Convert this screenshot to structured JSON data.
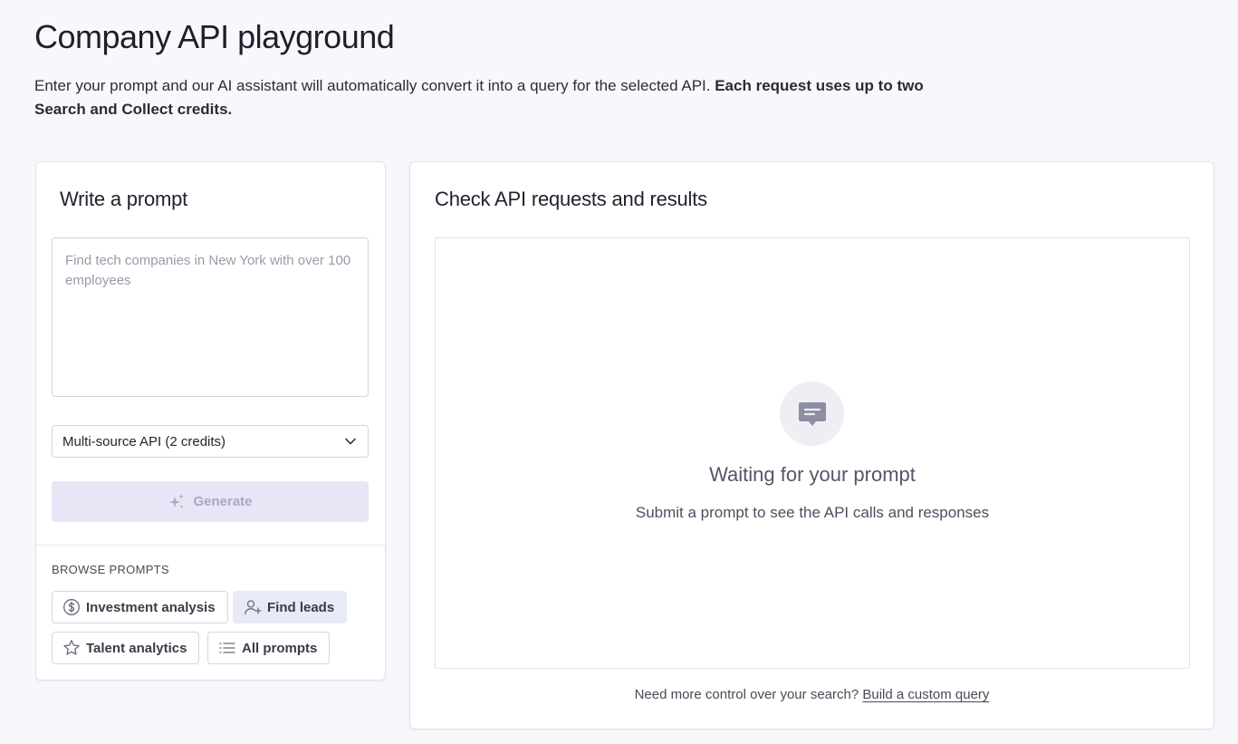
{
  "page": {
    "title": "Company API playground",
    "intro_text": "Enter your prompt and our AI assistant will automatically convert it into a query for the selected API. ",
    "intro_bold": "Each request uses up to two Search and Collect credits."
  },
  "prompt_panel": {
    "title": "Write a prompt",
    "prompt_value": "",
    "prompt_placeholder": "Find tech companies in New York with over 100 employees",
    "api_select": {
      "selected": "Multi-source API (2 credits)",
      "icon": "chevron-down-icon"
    },
    "generate_button": {
      "label": "Generate",
      "icon": "sparkle-icon",
      "disabled": true
    },
    "browse": {
      "label": "BROWSE PROMPTS",
      "chips": [
        {
          "label": "Investment analysis",
          "icon": "dollar-circle-icon",
          "active": false
        },
        {
          "label": "Find leads",
          "icon": "user-plus-icon",
          "active": true
        },
        {
          "label": "Talent analytics",
          "icon": "star-icon",
          "active": false
        },
        {
          "label": "All prompts",
          "icon": "list-icon",
          "active": false
        }
      ]
    }
  },
  "results_panel": {
    "title": "Check API requests and results",
    "empty_state": {
      "icon": "chat-bubble-icon",
      "title": "Waiting for your prompt",
      "subtitle": "Submit a prompt to see the API calls and responses"
    },
    "footer": {
      "text": "Need more control over your search? ",
      "link": "Build a custom query"
    }
  },
  "colors": {
    "background": "#f8f8fc",
    "card": "#ffffff",
    "border": "#e3e3ec",
    "button_disabled_bg": "#e7e6f6",
    "button_disabled_text": "#a9a8c2",
    "active_chip_bg": "#e8eaf8"
  }
}
